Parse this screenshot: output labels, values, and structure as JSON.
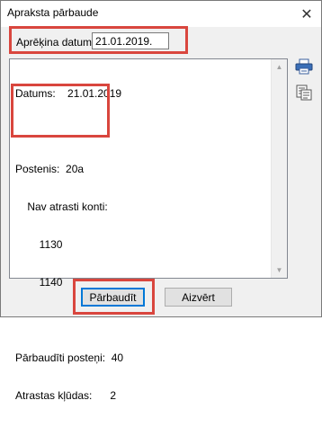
{
  "window": {
    "title": "Apraksta pārbaude",
    "close_glyph": "✕"
  },
  "date_field": {
    "label": "Aprēķina datums:",
    "value": "21.01.2019."
  },
  "report_lines": [
    "Datums:    21.01.2019",
    "",
    "Postenis:  20a",
    "    Nav atrasti konti:",
    "        1130",
    "        1140",
    "",
    "Pārbaudīti posteņi:  40",
    "Atrastas kļūdas:      2"
  ],
  "scrollbar": {
    "up_glyph": "▲",
    "down_glyph": "▼"
  },
  "icons": {
    "print": "printer-icon",
    "preview": "document-preview-icon"
  },
  "buttons": {
    "check_label": "Pārbaudīt",
    "close_label": "Aizvērt"
  },
  "colors": {
    "highlight": "#d9463e",
    "default_button_border": "#0078d7"
  }
}
